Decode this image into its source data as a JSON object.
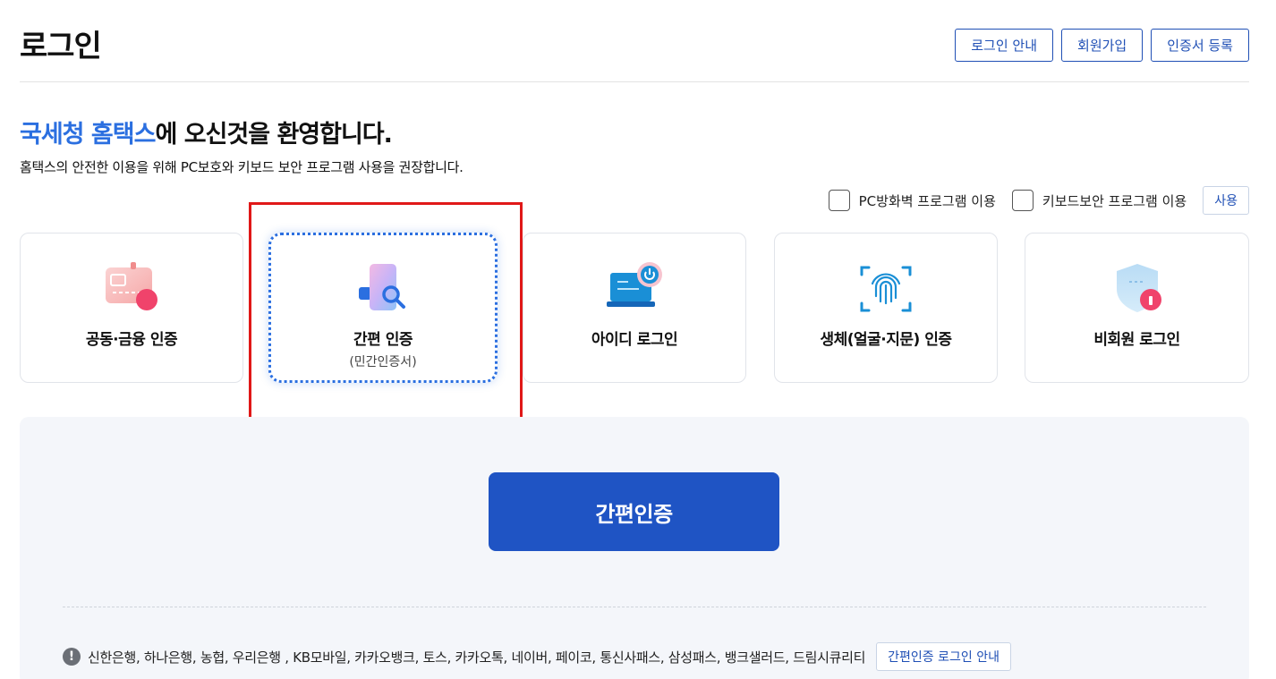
{
  "header": {
    "title": "로그인",
    "buttons": [
      "로그인 안내",
      "회원가입",
      "인증서 등록"
    ]
  },
  "welcome": {
    "brand": "국세청 홈택스",
    "rest": "에 오신것을 환영합니다.",
    "subtext": "홈택스의 안전한 이용을 위해 PC보호와 키보드 보안 프로그램 사용을 권장합니다."
  },
  "options": {
    "firewall_label": "PC방화벽 프로그램 이용",
    "keyboard_label": "키보드보안 프로그램 이용",
    "use_button": "사용"
  },
  "methods": [
    {
      "label": "공동·금융 인증",
      "sublabel": "",
      "icon": "certificate-card-icon"
    },
    {
      "label": "간편 인증",
      "sublabel": "(민간인증서)",
      "icon": "simple-auth-phone-icon",
      "selected": true
    },
    {
      "label": "아이디 로그인",
      "sublabel": "",
      "icon": "laptop-power-icon"
    },
    {
      "label": "생체(얼굴·지문) 인증",
      "sublabel": "",
      "icon": "fingerprint-icon"
    },
    {
      "label": "비회원 로그인",
      "sublabel": "",
      "icon": "shield-lock-icon"
    }
  ],
  "panel": {
    "primary_button": "간편인증",
    "notice": "신한은행, 하나은행, 농협, 우리은행 , KB모바일, 카카오뱅크, 토스, 카카오톡, 네이버, 페이코, 통신사패스, 삼성패스, 뱅크샐러드, 드림시큐리티",
    "guide_button": "간편인증 로그인 안내",
    "info_glyph": "!"
  },
  "colors": {
    "brand_blue": "#2b6fe0",
    "primary_button": "#1f54c4",
    "highlight_red": "#e01818"
  }
}
